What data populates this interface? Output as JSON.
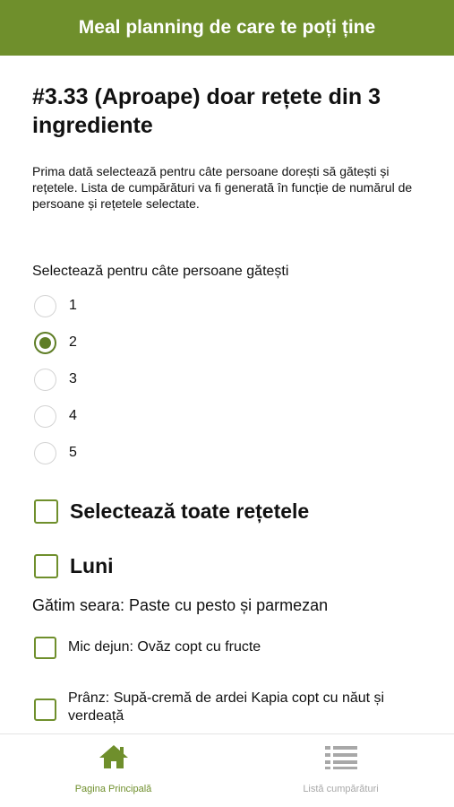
{
  "header": {
    "title": "Meal planning de care te poți ține"
  },
  "page": {
    "title": "#3.33 (Aproape) doar rețete din 3 ingrediente",
    "intro": "Prima dată selectează pentru câte persoane dorești să gătești și rețetele. Lista de cumpărături va fi generată în funcție de numărul de persoane și rețetele selectate."
  },
  "persons": {
    "label": "Selectează pentru câte persoane gătești",
    "options": [
      "1",
      "2",
      "3",
      "4",
      "5"
    ],
    "selected": "2"
  },
  "select_all": {
    "label": "Selectează toate rețetele",
    "checked": false
  },
  "day": {
    "name": "Luni",
    "checked": false,
    "note": "Gătim seara: Paste cu pesto și parmezan",
    "items": [
      {
        "label": "Mic dejun: Ovăz copt cu fructe",
        "checked": false
      },
      {
        "label": "Prânz: Supă-cremă de ardei Kapia copt cu năut și verdeață",
        "checked": false
      }
    ]
  },
  "tabs": [
    {
      "label": "Pagina Principală",
      "icon": "home-icon",
      "active": true
    },
    {
      "label": "Listă cumpărături",
      "icon": "list-icon",
      "active": false
    }
  ],
  "colors": {
    "accent": "#6f8f2c",
    "inactive": "#a8a8a8"
  }
}
